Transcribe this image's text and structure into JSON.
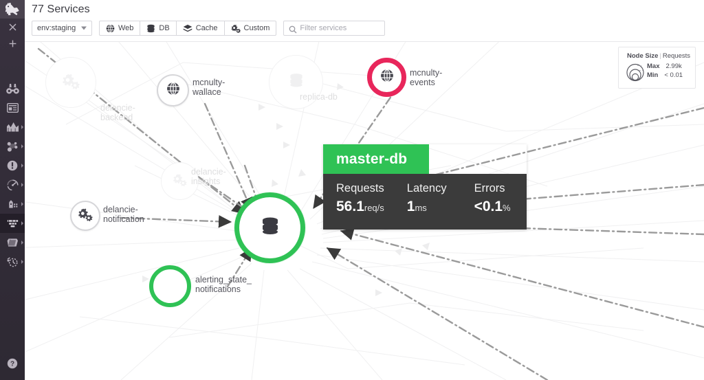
{
  "app": {
    "logo_icon": "datadog-dog-logo",
    "page_title": "77 Services"
  },
  "sidebar": {
    "top_actions": [
      {
        "name": "close",
        "icon": "close-icon",
        "glyph": "×"
      },
      {
        "name": "add",
        "icon": "plus-icon",
        "glyph": "+"
      }
    ],
    "items": [
      {
        "name": "watchdog",
        "icon": "binoculars-icon",
        "has_caret": false,
        "selected": false
      },
      {
        "name": "dashboards",
        "icon": "dashboard-icon",
        "has_caret": false,
        "selected": false
      },
      {
        "name": "metrics",
        "icon": "mountain-chart-icon",
        "has_caret": true,
        "selected": false
      },
      {
        "name": "integrations",
        "icon": "nodes-network-icon",
        "has_caret": true,
        "selected": false
      },
      {
        "name": "monitors",
        "icon": "alert-exclamation-icon",
        "has_caret": true,
        "selected": false
      },
      {
        "name": "synthetics",
        "icon": "gauge-icon",
        "has_caret": true,
        "selected": false
      },
      {
        "name": "infrastructure",
        "icon": "host-map-icon",
        "has_caret": true,
        "selected": false
      },
      {
        "name": "apm",
        "icon": "apm-funnel-icon",
        "has_caret": true,
        "selected": true
      },
      {
        "name": "logs",
        "icon": "logs-book-icon",
        "has_caret": true,
        "selected": false
      },
      {
        "name": "profiler",
        "icon": "profiler-stopwatch-icon",
        "has_caret": true,
        "selected": false
      }
    ],
    "help": {
      "name": "help",
      "icon": "help-question-icon",
      "glyph": "?"
    }
  },
  "toolbar": {
    "env_select": {
      "value": "env:staging",
      "icon": "chevron-down-icon"
    },
    "type_filters": [
      {
        "label": "Web",
        "icon": "globe-icon",
        "active": false
      },
      {
        "label": "DB",
        "icon": "database-icon",
        "active": false
      },
      {
        "label": "Cache",
        "icon": "layers-icon",
        "active": false
      },
      {
        "label": "Custom",
        "icon": "gears-icon",
        "active": false
      }
    ],
    "search": {
      "placeholder": "Filter services",
      "value": "",
      "icon": "search-icon"
    }
  },
  "legend": {
    "title_label": "Node Size",
    "title_divider": "|",
    "title_metric": "Requests",
    "glyph": "concentric-circles-icon",
    "rows": [
      {
        "label": "Max",
        "value": "2.99k"
      },
      {
        "label": "Min",
        "value": "< 0.01"
      }
    ]
  },
  "tooltip": {
    "service_name": "master-db",
    "metrics": [
      {
        "label": "Requests",
        "value": "56.1",
        "unit": "req/s"
      },
      {
        "label": "Latency",
        "value": "1",
        "unit": "ms"
      },
      {
        "label": "Errors",
        "value": "<0.1",
        "unit": "%"
      }
    ],
    "accent_color": "#2fc255",
    "body_color": "#3b3b3b"
  },
  "graph": {
    "status_colors": {
      "ok": "#2fc255",
      "error": "#e8265b",
      "neutral": "#d6d6d9",
      "faded": "#f2f2f3"
    },
    "nodes": [
      {
        "id": "mcnulty-wallace",
        "label": "mcnulty-\nwallace",
        "icon": "globe-icon",
        "state": "neutral",
        "faded": false
      },
      {
        "id": "mcnulty-events",
        "label": "mcnulty-\nevents",
        "icon": "globe-icon",
        "state": "error",
        "faded": false
      },
      {
        "id": "delancie-notification",
        "label": "delancie-\nnotification",
        "icon": "gears-icon",
        "state": "neutral",
        "faded": false
      },
      {
        "id": "master-db",
        "label": "",
        "icon": "database-icon",
        "state": "ok",
        "faded": false
      },
      {
        "id": "alerting_state_notifications",
        "label": "alerting_state_\nnotifications",
        "icon": "none",
        "state": "ok",
        "faded": false
      },
      {
        "id": "delancie-backend",
        "label": "delancie-\nbackend",
        "icon": "gears-icon",
        "state": "faded",
        "faded": true
      },
      {
        "id": "delancie-insights",
        "label": "delancie-\ninsights",
        "icon": "gears-icon",
        "state": "faded",
        "faded": true
      },
      {
        "id": "replica-db",
        "label": "replica-db",
        "icon": "database-icon",
        "state": "faded",
        "faded": true
      }
    ]
  }
}
